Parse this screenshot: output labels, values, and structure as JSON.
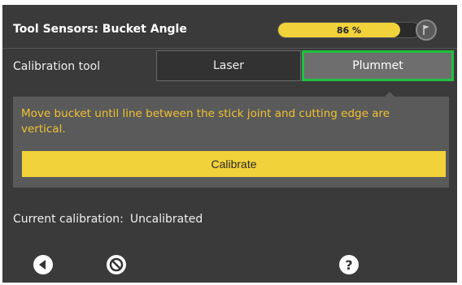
{
  "header": {
    "title": "Tool Sensors: Bucket Angle",
    "battery_label": "86 %",
    "battery_percent": 86
  },
  "calibration_tool": {
    "label": "Calibration tool",
    "options": [
      "Laser",
      "Plummet"
    ],
    "selected": "Plummet"
  },
  "panel": {
    "instruction": "Move bucket until line between the stick joint and cutting edge are vertical.",
    "calibrate_label": "Calibrate"
  },
  "status": {
    "label": "Current calibration:",
    "value": "Uncalibrated"
  },
  "footer": {
    "icons": [
      "back-icon",
      "cancel-icon",
      "help-icon"
    ],
    "help_glyph": "?"
  },
  "colors": {
    "background": "#3a3a3a",
    "accent_yellow": "#f1d23a",
    "instruction_text": "#f1c232",
    "selection_outline": "#20c040"
  }
}
